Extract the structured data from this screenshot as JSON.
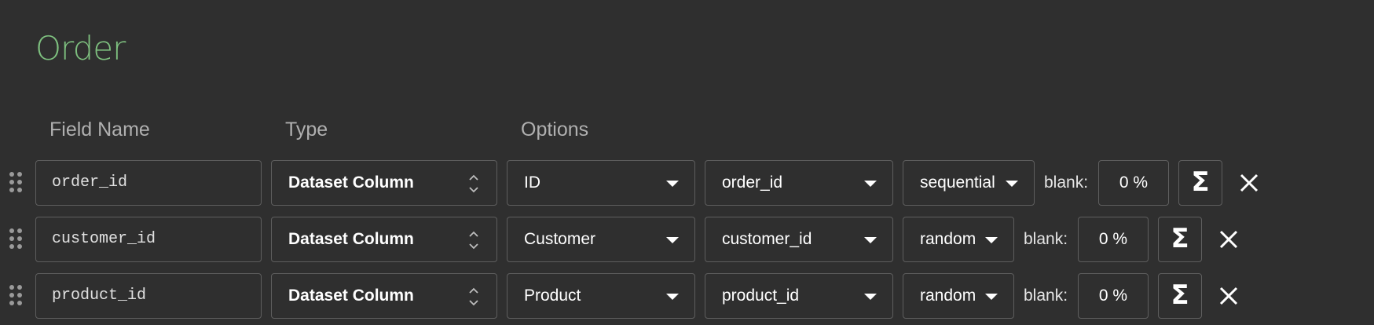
{
  "title": "Order",
  "headers": {
    "field_name": "Field Name",
    "type": "Type",
    "options": "Options"
  },
  "rows": [
    {
      "field_name": "order_id",
      "type": "Dataset Column",
      "option1": "ID",
      "option2": "order_id",
      "option3": "sequential",
      "blank_label": "blank:",
      "blank_value": "0 %"
    },
    {
      "field_name": "customer_id",
      "type": "Dataset Column",
      "option1": "Customer",
      "option2": "customer_id",
      "option3": "random",
      "blank_label": "blank:",
      "blank_value": "0 %"
    },
    {
      "field_name": "product_id",
      "type": "Dataset Column",
      "option1": "Product",
      "option2": "product_id",
      "option3": "random",
      "blank_label": "blank:",
      "blank_value": "0 %"
    }
  ],
  "sigma_symbol": "Σ",
  "colors": {
    "background": "#2f2f2f",
    "title": "#7ec07f",
    "border": "#5e5e5e",
    "header_text": "#b0b0b0"
  },
  "icons": {
    "drag": "drag-handle-icon",
    "updown": "updown-arrows-icon",
    "caret": "caret-down-icon",
    "sigma": "sigma-icon",
    "close": "close-icon"
  }
}
